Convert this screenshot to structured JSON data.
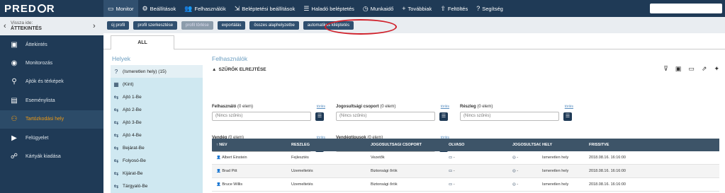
{
  "app": {
    "logo": "PRED",
    "logo_end": "R"
  },
  "menu": [
    {
      "label": "Monitor",
      "icon": "monitor-icon",
      "glyph": "▭"
    },
    {
      "label": "Beállítások",
      "icon": "gear-icon",
      "glyph": "⚙"
    },
    {
      "label": "Felhasználók",
      "icon": "users-icon",
      "glyph": "👥"
    },
    {
      "label": "Beléptetési beállítások",
      "icon": "door-icon",
      "glyph": "⇲"
    },
    {
      "label": "Haladó beléptetés",
      "icon": "sliders-icon",
      "glyph": "☰"
    },
    {
      "label": "Munkaidő",
      "icon": "clock-icon",
      "glyph": "◷"
    },
    {
      "label": "Továbbiak",
      "icon": "plus-icon",
      "glyph": "+"
    },
    {
      "label": "Feltöltés",
      "icon": "upload-icon",
      "glyph": "⇧"
    },
    {
      "label": "Segítség",
      "icon": "help-icon",
      "glyph": "?"
    }
  ],
  "sidebar": {
    "back_line1": "Vissza ide:",
    "back_line2": "ÁTTEKINTÉS",
    "items": [
      {
        "label": "Áttekintés",
        "icon": "overview-icon",
        "glyph": "▣"
      },
      {
        "label": "Monitorozás",
        "icon": "eye-icon",
        "glyph": "◉"
      },
      {
        "label": "Ajtók és térképek",
        "icon": "map-icon",
        "glyph": "⚲"
      },
      {
        "label": "Eseménylista",
        "icon": "list-icon",
        "glyph": "▤"
      },
      {
        "label": "Tartózkodási hely",
        "icon": "location-icon",
        "glyph": "⚇"
      },
      {
        "label": "Felügyelet",
        "icon": "supervision-icon",
        "glyph": "▶"
      },
      {
        "label": "Kártyák kiadása",
        "icon": "cards-icon",
        "glyph": "☍"
      }
    ]
  },
  "toolbar": {
    "buttons": [
      "új profil",
      "profil szerkesztése",
      "profil törlése",
      "exportálás",
      "összes alaphelyzetbe",
      "automatikus kiléptetés"
    ]
  },
  "tabs": {
    "all": "ALL"
  },
  "helyek": {
    "title": "Helyek",
    "items": [
      {
        "label": "(Ismeretlen hely) (15)",
        "glyph": "?"
      },
      {
        "label": "(Kint)",
        "glyph": "▦"
      },
      {
        "label": "Ajtó 1-Be",
        "glyph": "⇆"
      },
      {
        "label": "Ajtó 2-Be",
        "glyph": "⇆"
      },
      {
        "label": "Ajtó 3-Be",
        "glyph": "⇆"
      },
      {
        "label": "Ajtó 4-Be",
        "glyph": "⇆"
      },
      {
        "label": "Bejárat-Be",
        "glyph": "⇆"
      },
      {
        "label": "Folyosó-Be",
        "glyph": "⇆"
      },
      {
        "label": "Kijárat-Be",
        "glyph": "⇆"
      },
      {
        "label": "Tárgyaló-Be",
        "glyph": "⇆"
      }
    ]
  },
  "felhasznalok": {
    "title": "Felhasználók"
  },
  "filters": {
    "heading": "SZŰRŐK ELREJTÉSE",
    "torles": "törlés",
    "placeholder": "(Nincs szűrés)",
    "fields": [
      {
        "label": "Felhasználó",
        "count": "(0 elem)"
      },
      {
        "label": "Jogosultsági csoport",
        "count": "(0 elem)"
      },
      {
        "label": "Részleg",
        "count": "(0 elem)"
      },
      {
        "label": "Vendég",
        "count": "(0 elem)"
      },
      {
        "label": "Vendégtípusok",
        "count": "(0 elem)"
      }
    ]
  },
  "table": {
    "headers": [
      "↑ NÉV",
      "RÉSZLEG",
      "JOGOSULTSÁGI CSOPORT",
      "OLVASÓ",
      "JOGOSULTSÁG 2",
      "HELY",
      "FRISSÍTVE"
    ],
    "rows": [
      [
        "Albert Einstein",
        "Fejlesztés",
        "Vezetők",
        "-",
        "-",
        "Ismeretlen hely",
        "2018.08.16. 16:16:00"
      ],
      [
        "Brad Pitt",
        "Üzemeltetés",
        "Biztonsági őrök",
        "-",
        "-",
        "Ismeretlen hely",
        "2018.08.16. 16:16:00"
      ],
      [
        "Bruce Willis",
        "Üzemeltetés",
        "Biztonsági őrök",
        "-",
        "-",
        "Ismeretlen hely",
        "2018.08.16. 16:16:00"
      ]
    ]
  }
}
